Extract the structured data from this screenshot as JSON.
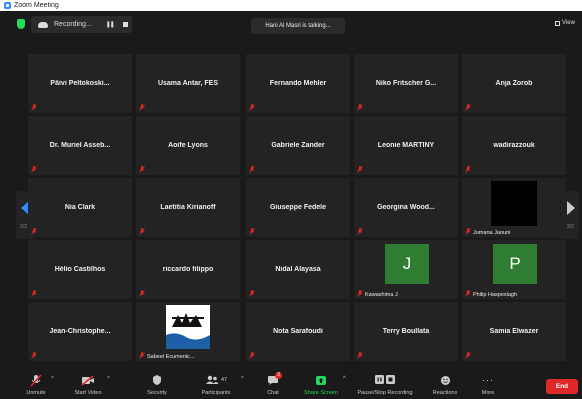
{
  "window": {
    "title": "Zoom Meeting"
  },
  "topbar": {
    "recording_label": "Recording...",
    "talking_label": "Hani Al Masri is talking...",
    "view_label": "View"
  },
  "tiles": [
    {
      "name": "Päivi  Peltokoski...",
      "small": ""
    },
    {
      "name": "Usama Antar, FES",
      "small": ""
    },
    {
      "name": "Fernando Mehler",
      "small": ""
    },
    {
      "name": "Niko Fritscher G...",
      "small": ""
    },
    {
      "name": "Anja Zorob",
      "small": ""
    },
    {
      "name": "Dr. Muriel Asseb...",
      "small": ""
    },
    {
      "name": "Aoife Lyons",
      "small": ""
    },
    {
      "name": "Gabriele Zander",
      "small": ""
    },
    {
      "name": "Leonie MARTINY",
      "small": ""
    },
    {
      "name": "wadirazzouk",
      "small": ""
    },
    {
      "name": "Nia Clark",
      "small": ""
    },
    {
      "name": "Laetitia Kirianoff",
      "small": ""
    },
    {
      "name": "Giuseppe Fedele",
      "small": ""
    },
    {
      "name": "Georgina  Wood...",
      "small": ""
    },
    {
      "name": "",
      "small": "Jumana Jaouni"
    },
    {
      "name": "Hélio Castilhos",
      "small": ""
    },
    {
      "name": "riccardo filippo",
      "small": ""
    },
    {
      "name": "Nidal Alayasa",
      "small": ""
    },
    {
      "name": "",
      "small": "Kawashima J",
      "avatar": "J",
      "avatar_color": "#2e7d32"
    },
    {
      "name": "",
      "small": "Philip Haspeslagh",
      "avatar": "P",
      "avatar_color": "#2e7d32"
    },
    {
      "name": "Jean-Christophe...",
      "small": ""
    },
    {
      "name": "",
      "small": "Sabeel Ecumenic..."
    },
    {
      "name": "Nota Sarafoudi",
      "small": ""
    },
    {
      "name": "Terry Boullata",
      "small": ""
    },
    {
      "name": "Samia Elwazer",
      "small": ""
    }
  ],
  "nav": {
    "left_page": "2/2",
    "right_page": "2/2"
  },
  "toolbar": {
    "unmute": "Unmute",
    "start_video": "Start Video",
    "security": "Security",
    "participants": "Participants",
    "participants_count": "47",
    "chat": "Chat",
    "chat_badge": "3",
    "share_screen": "Share Screen",
    "pause_stop": "Pause/Stop Recording",
    "reactions": "Reactions",
    "more": "More",
    "end": "End"
  },
  "colors": {
    "accent": "#2d8cff",
    "share_green": "#23d959",
    "end_red": "#e02828",
    "mic_muted": "#e02828"
  }
}
